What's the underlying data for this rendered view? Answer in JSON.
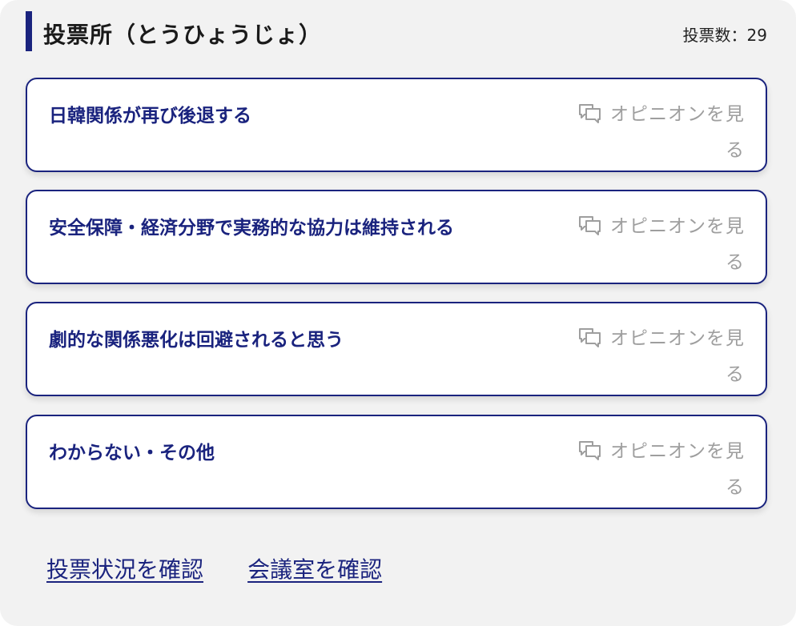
{
  "header": {
    "title": "投票所（とうひょうじょ）",
    "vote_count": "投票数：29"
  },
  "options": [
    {
      "label": "日韓関係が再び後退する",
      "opinion_link": "オピニオンを見る"
    },
    {
      "label": "安全保障・経済分野で実務的な協力は維持される",
      "opinion_link": "オピニオンを見る"
    },
    {
      "label": "劇的な関係悪化は回避されると思う",
      "opinion_link": "オピニオンを見る"
    },
    {
      "label": "わからない・その他",
      "opinion_link": "オピニオンを見る"
    }
  ],
  "footer": {
    "vote_status_link": "投票状況を確認",
    "meeting_room_link": "会議室を確認"
  },
  "colors": {
    "accent": "#1a237e",
    "muted": "#9e9e9e",
    "panel_bg": "#f2f2f2"
  },
  "icons": {
    "opinion": "chat-bubbles-icon"
  }
}
